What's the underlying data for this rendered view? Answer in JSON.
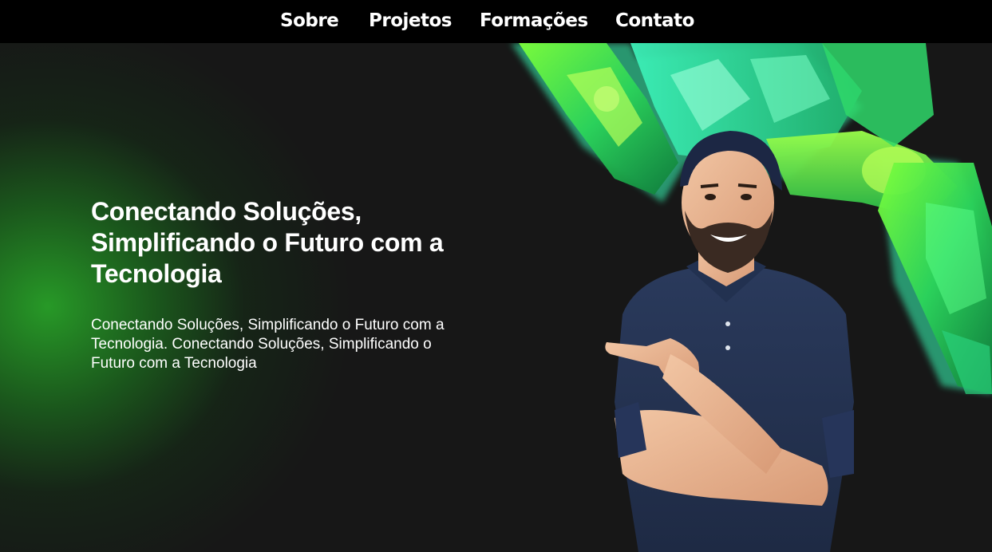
{
  "nav": {
    "links": [
      {
        "label": "Sobre"
      },
      {
        "label": "Projetos"
      },
      {
        "label": "Formações"
      },
      {
        "label": "Contato"
      }
    ]
  },
  "hero": {
    "title": "Conectando Soluções, Simplificando o Futuro com a Tecnologia",
    "description": "Conectando Soluções, Simplificando o Futuro com a Tecnologia. Conectando Soluções, Simplificando o Futuro com a Tecnologia",
    "image": {
      "icon": "smiling-man-with-robotic-hand-illustration"
    }
  },
  "colors": {
    "nav_background": "#000000",
    "page_background": "#171717",
    "accent_green": "#2aa52a",
    "robot_glow": "#3dffb0",
    "text": "#ffffff"
  }
}
